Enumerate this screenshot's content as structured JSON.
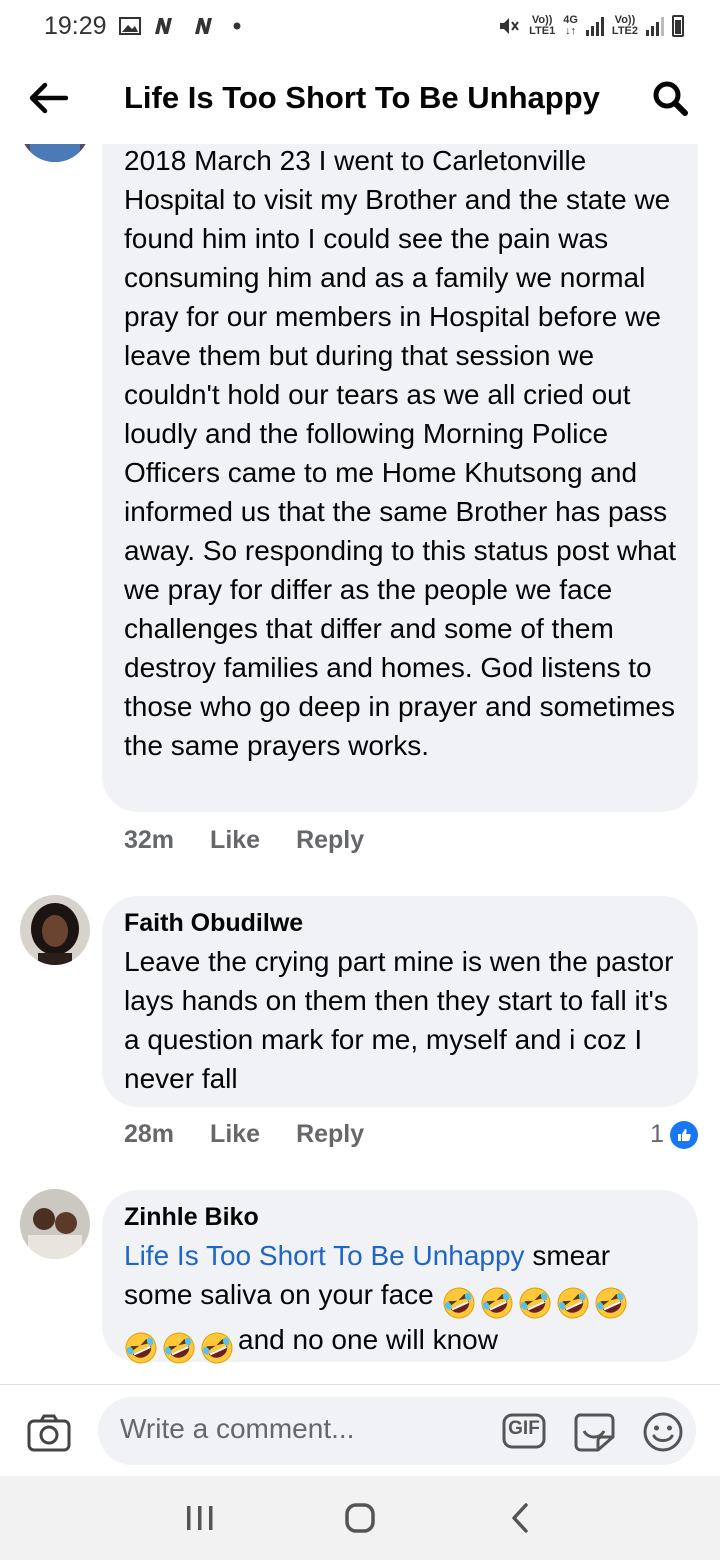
{
  "status_bar": {
    "time": "19:29",
    "sim1_top": "Vo))",
    "sim1_bottom": "LTE1",
    "network": "4G",
    "sim2_top": "Vo))",
    "sim2_bottom": "LTE2"
  },
  "header": {
    "title": "Life Is Too Short To Be Unhappy"
  },
  "comments": [
    {
      "author": "",
      "text": "2018 March 23 I went to Carletonville Hospital to visit my Brother and the state we found him into I could see the pain was consuming him and as a family we normal pray for our members in Hospital before we leave them but during that session we couldn't hold our tears as we all cried out loudly and the following Morning Police Officers came to me Home Khutsong and informed us that the same Brother has pass away. So responding to this status post what we pray for differ as the people we face challenges that differ and some of them destroy families and homes. God listens to those who go deep in prayer and sometimes the same prayers works.",
      "time": "32m",
      "like_label": "Like",
      "reply_label": "Reply"
    },
    {
      "author": "Faith Obudilwe",
      "text": "Leave the crying part mine is wen the pastor lays hands on them then they start to fall it's a question mark for me, myself and i coz I never fall",
      "time": "28m",
      "like_label": "Like",
      "reply_label": "Reply",
      "reaction_count": "1",
      "reaction_icon": "like-reaction-icon"
    },
    {
      "author": "Zinhle Biko",
      "mention": "Life Is Too Short To Be Unhappy",
      "text_part1": " smear some saliva on your face ",
      "text_part2": "and no one will know",
      "emoji_name": "rolling-on-floor-laughing-emoji",
      "emoji_count_part1": 5,
      "emoji_count_part2": 3
    }
  ],
  "composer": {
    "placeholder": "Write a comment...",
    "gif_label": "GIF"
  },
  "colors": {
    "bubble_bg": "#f0f2f5",
    "mention": "#1f65c6",
    "like_blue": "#1877f2",
    "meta_gray": "#65676b"
  }
}
